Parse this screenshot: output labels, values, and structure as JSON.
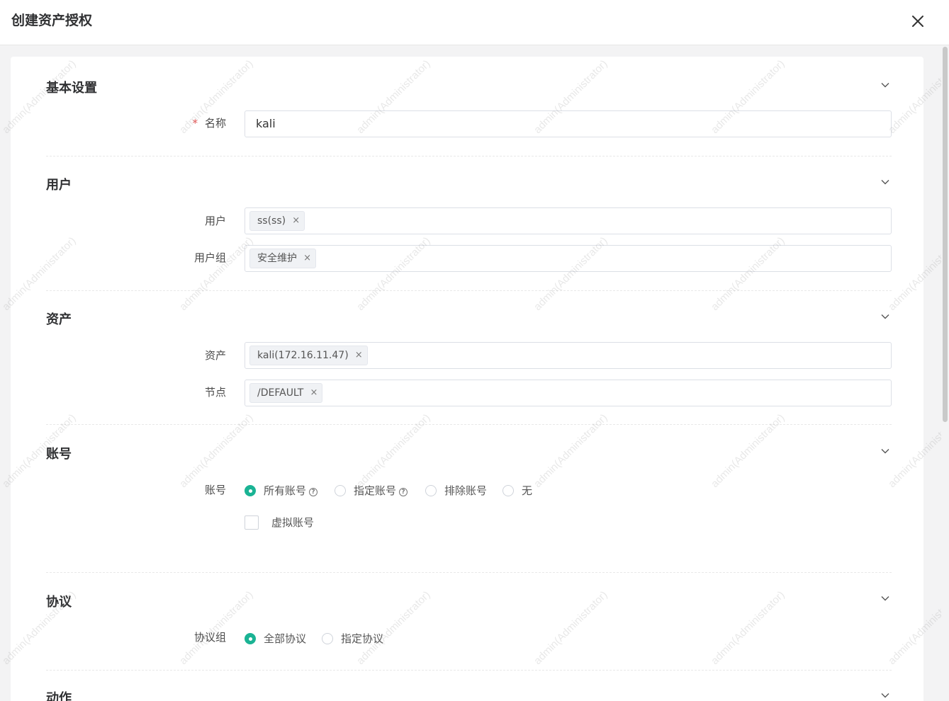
{
  "dialog": {
    "title": "创建资产授权",
    "close_icon": "close-icon"
  },
  "sections": {
    "basic": {
      "title": "基本设置",
      "name_label": "名称",
      "required_mark": "*",
      "name_value": "kali"
    },
    "users": {
      "title": "用户",
      "user_label": "用户",
      "user_tag": "ss(ss)",
      "group_label": "用户组",
      "group_tag": "安全维护"
    },
    "assets": {
      "title": "资产",
      "asset_label": "资产",
      "asset_tag": "kali(172.16.11.47)",
      "node_label": "节点",
      "node_tag": "/DEFAULT"
    },
    "accounts": {
      "title": "账号",
      "account_label": "账号",
      "options": [
        "所有账号",
        "指定账号",
        "排除账号",
        "无"
      ],
      "selected": "所有账号",
      "virtual_label": "虚拟账号",
      "virtual_checked": false
    },
    "protocols": {
      "title": "协议",
      "group_label": "协议组",
      "options": [
        "全部协议",
        "指定协议"
      ],
      "selected": "全部协议"
    },
    "actions": {
      "title": "动作"
    }
  },
  "tag_remove": "×",
  "help_mark": "?",
  "watermark": "admin(Administrator)",
  "colors": {
    "accent": "#1ab394",
    "required": "#e55353"
  }
}
